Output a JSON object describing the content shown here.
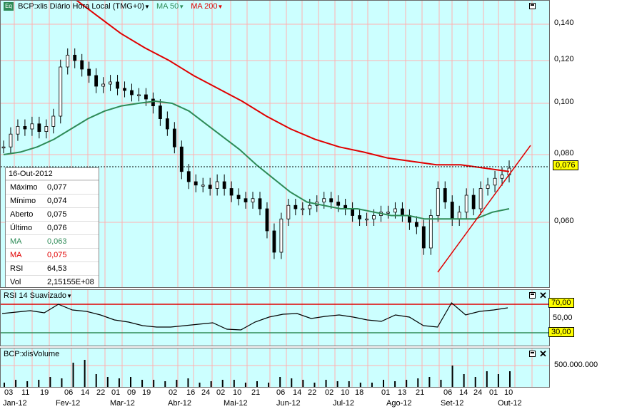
{
  "header": {
    "icon_text": "Eq",
    "symbol": "BCP:xlis Diário Hora Local (TMG+0)",
    "ma50_label": "MA 50",
    "ma200_label": "MA 200"
  },
  "info_box": {
    "date": "16-Out-2012",
    "rows": [
      {
        "label": "Máximo",
        "value": "0,077",
        "color": "#000000"
      },
      {
        "label": "Mínimo",
        "value": "0,074",
        "color": "#000000"
      },
      {
        "label": "Aberto",
        "value": "0,075",
        "color": "#000000"
      },
      {
        "label": "Último",
        "value": "0,076",
        "color": "#000000"
      },
      {
        "label": "MA",
        "value": "0,063",
        "color": "#2e8b57"
      },
      {
        "label": "MA",
        "value": "0,075",
        "color": "#e00000"
      },
      {
        "label": "RSI",
        "value": "64,53",
        "color": "#000000"
      },
      {
        "label": "Vol",
        "value": "2,15155E+08",
        "color": "#000000"
      }
    ]
  },
  "rsi_panel": {
    "title": "RSI 14 Suavizado",
    "upper_label": "70,00",
    "mid_label": "50,00",
    "lower_label": "30,00"
  },
  "volume_panel": {
    "title": "BCP:xlisVolume",
    "axis_label": "500.000.000"
  },
  "last_price_label": "0,076",
  "colors": {
    "background": "#ccffff",
    "ma50": "#2e8b57",
    "ma200": "#e00000",
    "price": "#000000",
    "grid": "#ffaaaa"
  },
  "chart_data": {
    "type": "candlestick",
    "title": "BCP:xlis Diário Hora Local (TMG+0)",
    "y_ticks": [
      "0,140",
      "0,120",
      "0,100",
      "0,080",
      "0,060"
    ],
    "y_tick_values": [
      0.14,
      0.12,
      0.1,
      0.08,
      0.06
    ],
    "ylim": [
      0.05,
      0.15
    ],
    "x_day_labels": [
      "03",
      "11",
      "19",
      "06",
      "14",
      "22",
      "01",
      "09",
      "19",
      "02",
      "16",
      "24",
      "02",
      "10",
      "21",
      "06",
      "14",
      "22",
      "02",
      "10",
      "18",
      "01",
      "13",
      "21",
      "06",
      "14",
      "24",
      "01",
      "10"
    ],
    "x_month_labels": [
      "Jan-12",
      "Fev-12",
      "Mar-12",
      "Abr-12",
      "Mai-12",
      "Jun-12",
      "Jul-12",
      "Ago-12",
      "Set-12",
      "Out-12"
    ],
    "series": [
      {
        "name": "BCP:xlis",
        "values": [
          0.083,
          0.088,
          0.091,
          0.09,
          0.092,
          0.089,
          0.091,
          0.095,
          0.117,
          0.123,
          0.12,
          0.116,
          0.113,
          0.108,
          0.109,
          0.11,
          0.107,
          0.106,
          0.104,
          0.104,
          0.102,
          0.099,
          0.094,
          0.09,
          0.083,
          0.075,
          0.072,
          0.071,
          0.071,
          0.07,
          0.072,
          0.07,
          0.068,
          0.067,
          0.066,
          0.067,
          0.064,
          0.058,
          0.053,
          0.061,
          0.065,
          0.064,
          0.064,
          0.065,
          0.066,
          0.067,
          0.066,
          0.065,
          0.064,
          0.062,
          0.061,
          0.061,
          0.062,
          0.063,
          0.063,
          0.064,
          0.062,
          0.06,
          0.059,
          0.054,
          0.062,
          0.07,
          0.066,
          0.061,
          0.063,
          0.068,
          0.064,
          0.07,
          0.071,
          0.073,
          0.074,
          0.076
        ]
      },
      {
        "name": "MA 50",
        "values": [
          0.08,
          0.081,
          0.083,
          0.086,
          0.09,
          0.094,
          0.097,
          0.099,
          0.1,
          0.101,
          0.1,
          0.097,
          0.092,
          0.087,
          0.082,
          0.077,
          0.073,
          0.069,
          0.066,
          0.065,
          0.064,
          0.064,
          0.063,
          0.062,
          0.062,
          0.061,
          0.061,
          0.061,
          0.061,
          0.063,
          0.064
        ]
      },
      {
        "name": "MA 200",
        "values": [
          0.155,
          0.145,
          0.135,
          0.127,
          0.12,
          0.113,
          0.107,
          0.101,
          0.095,
          0.09,
          0.086,
          0.083,
          0.081,
          0.079,
          0.078,
          0.077,
          0.077,
          0.076,
          0.075
        ]
      }
    ],
    "rsi_values": [
      57,
      59,
      61,
      58,
      70,
      62,
      60,
      55,
      48,
      45,
      40,
      38,
      38,
      40,
      42,
      44,
      35,
      34,
      45,
      52,
      56,
      57,
      50,
      53,
      55,
      52,
      48,
      46,
      55,
      52,
      40,
      38,
      72,
      55,
      60,
      62,
      65
    ],
    "volume_values": [
      0.2,
      0.3,
      0.25,
      0.3,
      0.4,
      0.35,
      0.9,
      1.0,
      0.5,
      0.4,
      0.35,
      0.4,
      0.3,
      0.3,
      0.25,
      0.3,
      0.35,
      0.2,
      0.25,
      0.3,
      0.3,
      0.2,
      0.25,
      0.2,
      0.4,
      0.35,
      0.3,
      0.2,
      0.3,
      0.25,
      0.25,
      0.2,
      0.2,
      0.3,
      0.25,
      0.3,
      0.35,
      0.4,
      0.3,
      0.8,
      0.5,
      0.4,
      0.6,
      0.5,
      0.6
    ]
  }
}
